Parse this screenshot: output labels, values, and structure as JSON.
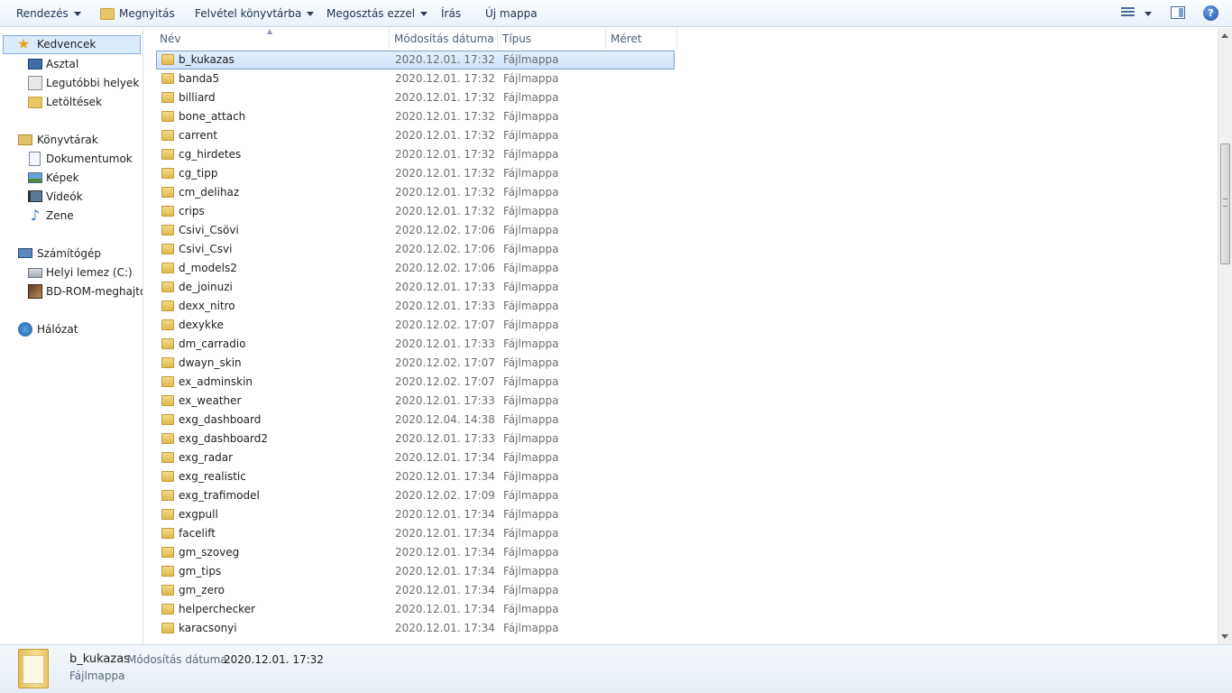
{
  "toolbar": {
    "organize": "Rendezés",
    "open": "Megnyitás",
    "include_library": "Felvétel könyvtárba",
    "share": "Megosztás ezzel",
    "burn": "Írás",
    "new_folder": "Új mappa",
    "help": "?"
  },
  "nav": {
    "favorites": "Kedvencek",
    "desktop": "Asztal",
    "recent": "Legutóbbi helyek",
    "downloads": "Letöltések",
    "libraries": "Könyvtárak",
    "documents": "Dokumentumok",
    "pictures": "Képek",
    "videos": "Videók",
    "music": "Zene",
    "computer": "Számítógép",
    "local_disk": "Helyi lemez (C:)",
    "bd_rom": "BD-ROM-meghajtó",
    "network": "Hálózat"
  },
  "columns": {
    "name": "Név",
    "modified": "Módosítás dátuma",
    "type": "Típus",
    "size": "Méret"
  },
  "files": [
    {
      "name": "b_kukazas",
      "date": "2020.12.01. 17:32",
      "type": "Fájlmappa"
    },
    {
      "name": "banda5",
      "date": "2020.12.01. 17:32",
      "type": "Fájlmappa"
    },
    {
      "name": "billiard",
      "date": "2020.12.01. 17:32",
      "type": "Fájlmappa"
    },
    {
      "name": "bone_attach",
      "date": "2020.12.01. 17:32",
      "type": "Fájlmappa"
    },
    {
      "name": "carrent",
      "date": "2020.12.01. 17:32",
      "type": "Fájlmappa"
    },
    {
      "name": "cg_hirdetes",
      "date": "2020.12.01. 17:32",
      "type": "Fájlmappa"
    },
    {
      "name": "cg_tipp",
      "date": "2020.12.01. 17:32",
      "type": "Fájlmappa"
    },
    {
      "name": "cm_delihaz",
      "date": "2020.12.01. 17:32",
      "type": "Fájlmappa"
    },
    {
      "name": "crips",
      "date": "2020.12.01. 17:32",
      "type": "Fájlmappa"
    },
    {
      "name": "Csivi_Csövi",
      "date": "2020.12.02. 17:06",
      "type": "Fájlmappa"
    },
    {
      "name": "Csivi_Csvi",
      "date": "2020.12.02. 17:06",
      "type": "Fájlmappa"
    },
    {
      "name": "d_models2",
      "date": "2020.12.02. 17:06",
      "type": "Fájlmappa"
    },
    {
      "name": "de_joinuzi",
      "date": "2020.12.01. 17:33",
      "type": "Fájlmappa"
    },
    {
      "name": "dexx_nitro",
      "date": "2020.12.01. 17:33",
      "type": "Fájlmappa"
    },
    {
      "name": "dexykke",
      "date": "2020.12.02. 17:07",
      "type": "Fájlmappa"
    },
    {
      "name": "dm_carradio",
      "date": "2020.12.01. 17:33",
      "type": "Fájlmappa"
    },
    {
      "name": "dwayn_skin",
      "date": "2020.12.02. 17:07",
      "type": "Fájlmappa"
    },
    {
      "name": "ex_adminskin",
      "date": "2020.12.02. 17:07",
      "type": "Fájlmappa"
    },
    {
      "name": "ex_weather",
      "date": "2020.12.01. 17:33",
      "type": "Fájlmappa"
    },
    {
      "name": "exg_dashboard",
      "date": "2020.12.04. 14:38",
      "type": "Fájlmappa"
    },
    {
      "name": "exg_dashboard2",
      "date": "2020.12.01. 17:33",
      "type": "Fájlmappa"
    },
    {
      "name": "exg_radar",
      "date": "2020.12.01. 17:34",
      "type": "Fájlmappa"
    },
    {
      "name": "exg_realistic",
      "date": "2020.12.01. 17:34",
      "type": "Fájlmappa"
    },
    {
      "name": "exg_trafimodel",
      "date": "2020.12.02. 17:09",
      "type": "Fájlmappa"
    },
    {
      "name": "exgpull",
      "date": "2020.12.01. 17:34",
      "type": "Fájlmappa"
    },
    {
      "name": "facelift",
      "date": "2020.12.01. 17:34",
      "type": "Fájlmappa"
    },
    {
      "name": "gm_szoveg",
      "date": "2020.12.01. 17:34",
      "type": "Fájlmappa"
    },
    {
      "name": "gm_tips",
      "date": "2020.12.01. 17:34",
      "type": "Fájlmappa"
    },
    {
      "name": "gm_zero",
      "date": "2020.12.01. 17:34",
      "type": "Fájlmappa"
    },
    {
      "name": "helperchecker",
      "date": "2020.12.01. 17:34",
      "type": "Fájlmappa"
    },
    {
      "name": "karacsonyi",
      "date": "2020.12.01. 17:34",
      "type": "Fájlmappa"
    }
  ],
  "details": {
    "name": "b_kukazas",
    "modified_label": "Módosítás dátuma:",
    "modified_value": "2020.12.01. 17:32",
    "type": "Fájlmappa"
  }
}
